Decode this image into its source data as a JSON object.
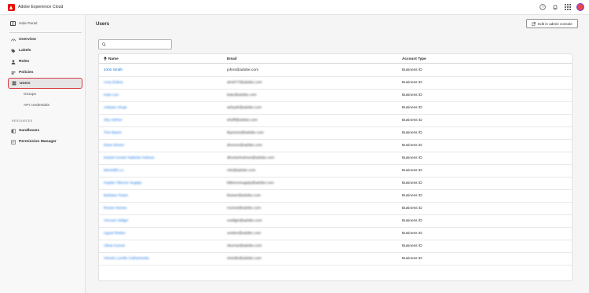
{
  "app": {
    "title": "Adobe Experience Cloud"
  },
  "sidebar": {
    "hide_panel": "Hide Panel",
    "items": [
      {
        "label": "Overview",
        "icon": "overview-icon"
      },
      {
        "label": "Labels",
        "icon": "tag-icon"
      },
      {
        "label": "Roles",
        "icon": "user-icon"
      },
      {
        "label": "Policies",
        "icon": "policy-icon"
      },
      {
        "label": "Users",
        "icon": "users-icon",
        "active": true
      },
      {
        "label": "Groups"
      },
      {
        "label": "API credentials"
      }
    ],
    "section_label": "RESOURCES",
    "resources": [
      {
        "label": "Sandboxes",
        "icon": "sandbox-icon"
      },
      {
        "label": "Permission Manager",
        "icon": "permission-manager-icon"
      }
    ]
  },
  "main": {
    "title": "Users",
    "edit_button": "Edit in admin console",
    "search_placeholder": ""
  },
  "table": {
    "headers": {
      "name": "Name",
      "email": "Email",
      "account_type": "Account Type"
    },
    "rows": [
      {
        "name": "John Smith",
        "email": "johns@adobe.com",
        "type": "Business ID",
        "blurred": false
      },
      {
        "name": "Amy Dukes",
        "email": "ahoh77@adobe.com",
        "type": "Business ID",
        "blurred": true
      },
      {
        "name": "Kate Lee",
        "email": "kate@adobe.com",
        "type": "Business ID",
        "blurred": true
      },
      {
        "name": "Ashyan Ahuja",
        "email": "ashyah@adobe.com",
        "type": "Business ID",
        "blurred": true
      },
      {
        "name": "Sky Hefner",
        "email": "sheff@adobe.com",
        "type": "Business ID",
        "blurred": true
      },
      {
        "name": "Tom Byers",
        "email": "tbyersns@adobe.com",
        "type": "Business ID",
        "blurred": true
      },
      {
        "name": "Dave Moore",
        "email": "dmoore@adobe.com",
        "type": "Business ID",
        "blurred": true
      },
      {
        "name": "Daniel Hunter Nabiela Holmes",
        "email": "dhunterholmes@adobe.com",
        "type": "Business ID",
        "blurred": true
      },
      {
        "name": "Meredith Lo",
        "email": "mlo@adobe.com",
        "type": "Business ID",
        "blurred": true
      },
      {
        "name": "Kaylan Tiberon Sugaty",
        "email": "ktiberonsugaty@adobe.com",
        "type": "Business ID",
        "blurred": true
      },
      {
        "name": "Barbara Tower",
        "email": "btower@adobe.com",
        "type": "Business ID",
        "blurred": true
      },
      {
        "name": "Renee Nunes",
        "email": "rnunes@adobe.com",
        "type": "Business ID",
        "blurred": true
      },
      {
        "name": "Vincent Vellgin",
        "email": "vvellgin@adobe.com",
        "type": "Business ID",
        "blurred": true
      },
      {
        "name": "Ugust Rieker",
        "email": "urieker@adobe.com",
        "type": "Business ID",
        "blurred": true
      },
      {
        "name": "Vikas Kumar",
        "email": "vkumar@adobe.com",
        "type": "Business ID",
        "blurred": true
      },
      {
        "name": "Vinesh Lorelle Catharinette",
        "email": "vlorelle@adobe.com",
        "type": "Business ID",
        "blurred": true
      }
    ]
  },
  "colors": {
    "accent": "#1473e6",
    "active_outline": "#d7373f",
    "brand": "#eb1000"
  }
}
